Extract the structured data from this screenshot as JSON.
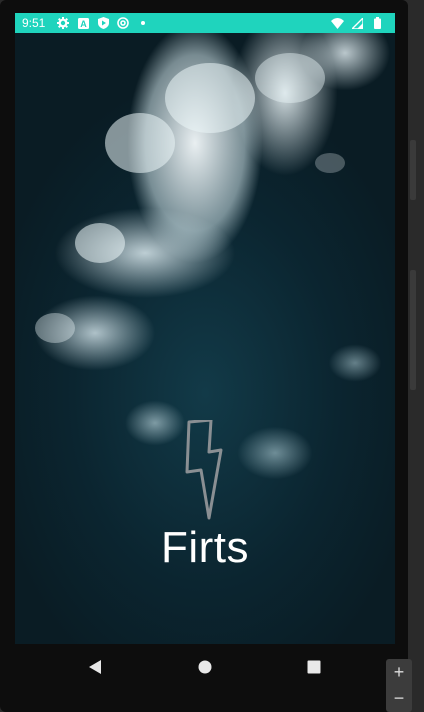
{
  "status_bar": {
    "time": "9:51",
    "left_icons": [
      "settings-icon",
      "a-icon",
      "play-protect-icon",
      "at-icon",
      "dot-icon"
    ],
    "right_icons": [
      "wifi-icon",
      "signal-icon",
      "battery-icon"
    ],
    "background_color": "#1fd4bd"
  },
  "splash": {
    "title": "Firts",
    "logo_icon": "lightning-bolt-icon",
    "background": "ocean-waves-aerial-image"
  },
  "navigation": {
    "buttons": [
      "back-icon",
      "home-icon",
      "recents-icon"
    ]
  },
  "zoom": {
    "in_label": "+",
    "out_label": "−"
  }
}
